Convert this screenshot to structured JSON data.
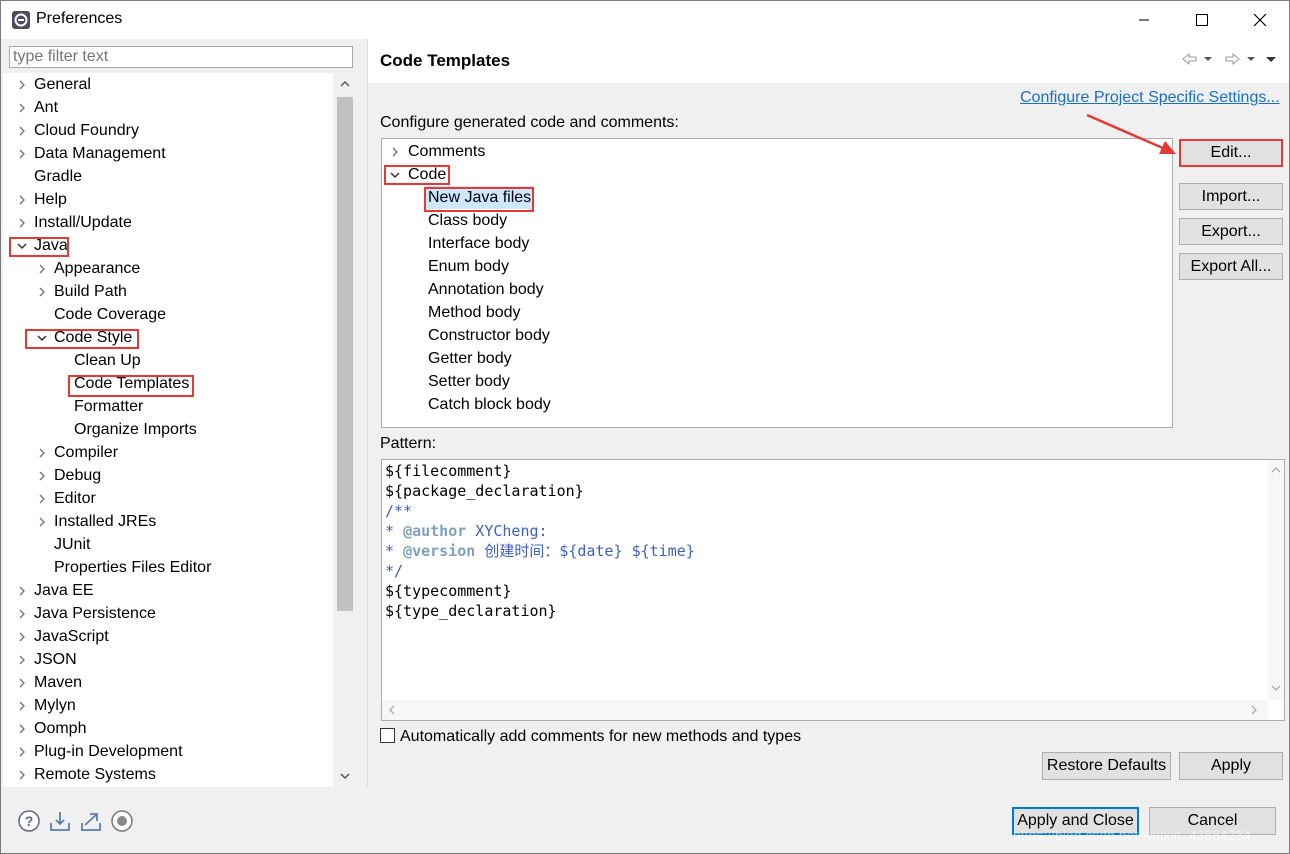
{
  "window": {
    "title": "Preferences",
    "controls": [
      "minimize",
      "maximize",
      "close"
    ]
  },
  "filter": {
    "placeholder": "type filter text"
  },
  "left_tree": [
    {
      "label": "General",
      "expand": "collapsed"
    },
    {
      "label": "Ant",
      "expand": "collapsed"
    },
    {
      "label": "Cloud Foundry",
      "expand": "collapsed"
    },
    {
      "label": "Data Management",
      "expand": "collapsed"
    },
    {
      "label": "Gradle",
      "expand": "none"
    },
    {
      "label": "Help",
      "expand": "collapsed"
    },
    {
      "label": "Install/Update",
      "expand": "collapsed"
    },
    {
      "label": "Java",
      "expand": "expanded"
    },
    {
      "label": "Appearance",
      "expand": "collapsed"
    },
    {
      "label": "Build Path",
      "expand": "collapsed"
    },
    {
      "label": "Code Coverage",
      "expand": "none"
    },
    {
      "label": "Code Style",
      "expand": "expanded"
    },
    {
      "label": "Clean Up",
      "expand": "none"
    },
    {
      "label": "Code Templates",
      "expand": "none"
    },
    {
      "label": "Formatter",
      "expand": "none"
    },
    {
      "label": "Organize Imports",
      "expand": "none"
    },
    {
      "label": "Compiler",
      "expand": "collapsed"
    },
    {
      "label": "Debug",
      "expand": "collapsed"
    },
    {
      "label": "Editor",
      "expand": "collapsed"
    },
    {
      "label": "Installed JREs",
      "expand": "collapsed"
    },
    {
      "label": "JUnit",
      "expand": "none"
    },
    {
      "label": "Properties Files Editor",
      "expand": "none"
    },
    {
      "label": "Java EE",
      "expand": "collapsed"
    },
    {
      "label": "Java Persistence",
      "expand": "collapsed"
    },
    {
      "label": "JavaScript",
      "expand": "collapsed"
    },
    {
      "label": "JSON",
      "expand": "collapsed"
    },
    {
      "label": "Maven",
      "expand": "collapsed"
    },
    {
      "label": "Mylyn",
      "expand": "collapsed"
    },
    {
      "label": "Oomph",
      "expand": "collapsed"
    },
    {
      "label": "Plug-in Development",
      "expand": "collapsed"
    },
    {
      "label": "Remote Systems",
      "expand": "collapsed"
    }
  ],
  "right": {
    "title": "Code Templates",
    "config_link": "Configure Project Specific Settings...",
    "configure_label": "Configure generated code and comments:",
    "templates_tree": [
      {
        "label": "Comments",
        "expand": "collapsed"
      },
      {
        "label": "Code",
        "expand": "expanded"
      },
      {
        "label": "New Java files",
        "selected": true
      },
      {
        "label": "Class body"
      },
      {
        "label": "Interface body"
      },
      {
        "label": "Enum body"
      },
      {
        "label": "Annotation body"
      },
      {
        "label": "Method body"
      },
      {
        "label": "Constructor body"
      },
      {
        "label": "Getter body"
      },
      {
        "label": "Setter body"
      },
      {
        "label": "Catch block body"
      }
    ],
    "buttons": {
      "edit": "Edit...",
      "import": "Import...",
      "export": "Export...",
      "export_all": "Export All..."
    },
    "pattern_label": "Pattern:",
    "pattern_lines": [
      {
        "text": "${filecomment}",
        "kind": "plain"
      },
      {
        "text": "${package_declaration}",
        "kind": "plain"
      },
      {
        "text": "/**",
        "kind": "comment"
      },
      {
        "prefix": "* ",
        "tag": "@author",
        "text": " XYCheng:",
        "kind": "javadoc"
      },
      {
        "prefix": "* ",
        "tag": "@version",
        "text": " 创建时间：${date} ${time}",
        "kind": "javadoc"
      },
      {
        "text": "*/",
        "kind": "comment"
      },
      {
        "text": "${typecomment}",
        "kind": "plain"
      },
      {
        "text": "${type_declaration}",
        "kind": "plain"
      }
    ],
    "auto_comment_label": "Automatically add comments for new methods and types",
    "auto_comment_checked": false,
    "restore_defaults": "Restore Defaults",
    "apply": "Apply"
  },
  "footer": {
    "apply_close": "Apply and Close",
    "cancel": "Cancel",
    "icons": [
      "help-icon",
      "import-icon",
      "export-icon",
      "record-icon"
    ],
    "watermark": "https://blog.csdn.net/weixin_43884234"
  },
  "colors": {
    "link": "#1a6fc6",
    "highlight": "#e53935",
    "selection": "#cce8ff",
    "comment": "#3f5fbf",
    "javadoc_tag": "#7f9fbf"
  }
}
